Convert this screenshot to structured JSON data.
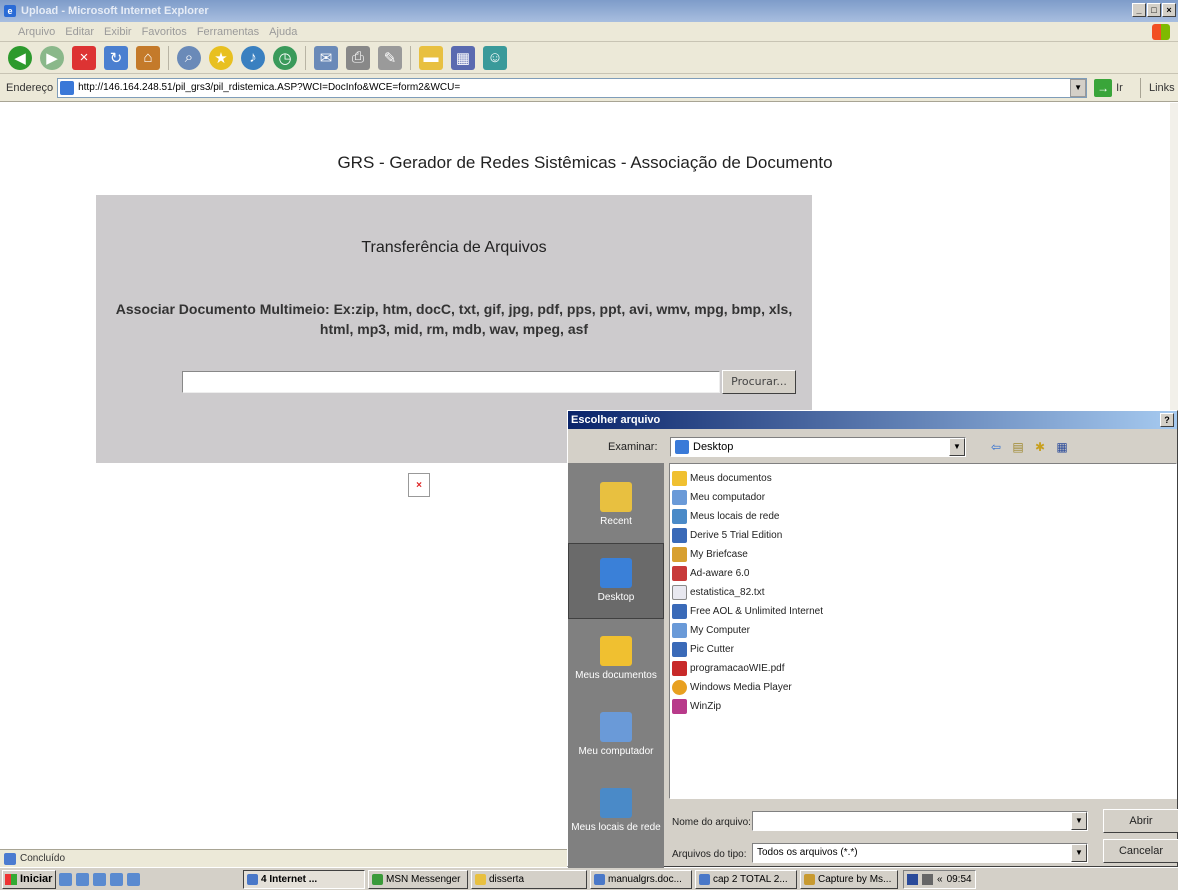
{
  "window": {
    "title": "Upload - Microsoft Internet Explorer"
  },
  "menu": [
    "Arquivo",
    "Editar",
    "Exibir",
    "Favoritos",
    "Ferramentas",
    "Ajuda"
  ],
  "address": {
    "label": "Endereço",
    "url": "http://146.164.248.51/pil_grs3/pil_rdistemica.ASP?WCI=DocInfo&WCE=form2&WCU=",
    "go_label": "Ir",
    "links_label": "Links"
  },
  "page": {
    "title": "GRS - Gerador de Redes Sistêmicas - Associação de Documento",
    "heading": "Transferência de Arquivos",
    "description": "Associar Documento Multimeio: Ex:zip, htm, docC, txt, gif, jpg, pdf, pps, ppt, avi, wmv, mpg, bmp, xls, html, mp3, mid, rm, mdb, wav, mpeg, asf",
    "browse_label": "Procurar..."
  },
  "status": {
    "text": "Concluído"
  },
  "dialog": {
    "title": "Escolher arquivo",
    "look_in_label": "Examinar:",
    "look_in_value": "Desktop",
    "places": [
      "Recent",
      "Desktop",
      "Meus documentos",
      "Meu computador",
      "Meus locais de rede"
    ],
    "files": [
      "Meus documentos",
      "Meu computador",
      "Meus locais de rede",
      "Derive 5 Trial Edition",
      "My Briefcase",
      "Ad-aware 6.0",
      "estatistica_82.txt",
      "Free AOL & Unlimited Internet",
      "My Computer",
      "Pic Cutter",
      "programacaoWIE.pdf",
      "Windows Media Player",
      "WinZip"
    ],
    "filename_label": "Nome do arquivo:",
    "filename_value": "",
    "filetype_label": "Arquivos do tipo:",
    "filetype_value": "Todos os arquivos (*.*)",
    "open_label": "Abrir",
    "cancel_label": "Cancelar"
  },
  "taskbar": {
    "start_label": "Iniciar",
    "tasks": [
      "4 Internet ...",
      "MSN Messenger",
      "disserta",
      "manualgrs.doc...",
      "cap 2 TOTAL 2...",
      "Capture by Ms..."
    ],
    "clock": "09:54"
  }
}
